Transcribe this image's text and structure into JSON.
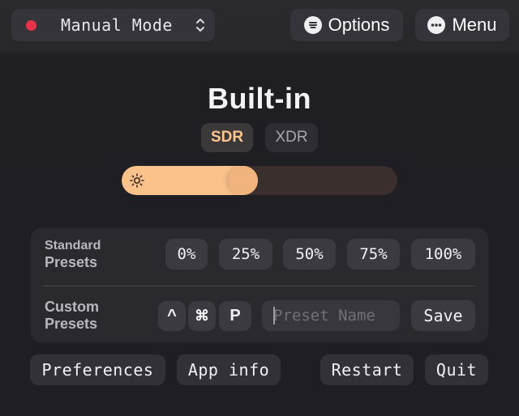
{
  "topbar": {
    "mode_label": "Manual Mode",
    "mode_status_color": "#e8344a",
    "options_label": "Options",
    "menu_label": "Menu",
    "icons": {
      "mode_chevron": "chevron-up-down-icon",
      "options": "list-circle-icon",
      "menu": "ellipsis-circle-icon"
    }
  },
  "display": {
    "name": "Built-in",
    "tabs": [
      {
        "label": "SDR",
        "selected": true
      },
      {
        "label": "XDR",
        "selected": false
      }
    ]
  },
  "brightness": {
    "level": 0.5,
    "icon": "sun-icon",
    "fill_color": "#fcc28c"
  },
  "presets": {
    "standard_label_line1": "Standard",
    "standard_label_line2": "Presets",
    "standard_values": [
      "0%",
      "25%",
      "50%",
      "75%",
      "100%"
    ],
    "custom_label_line1": "Custom",
    "custom_label_line2": "Presets",
    "hotkey_keys": [
      "^",
      "⌘",
      "P"
    ],
    "name_placeholder": "Preset Name",
    "name_value": "",
    "save_label": "Save"
  },
  "footer": {
    "preferences_label": "Preferences",
    "app_info_label": "App info",
    "restart_label": "Restart",
    "quit_label": "Quit"
  }
}
